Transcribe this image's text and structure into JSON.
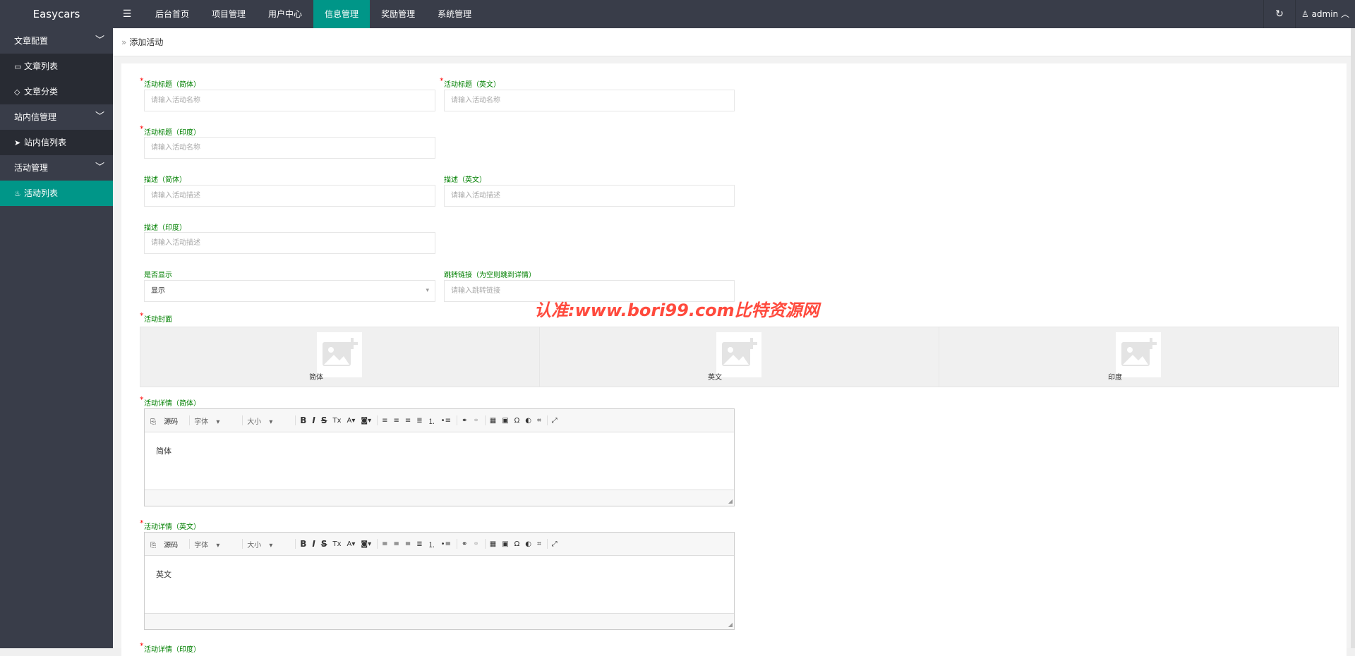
{
  "app": {
    "logo": "Easycars",
    "menu_icon": "menu-icon",
    "refresh_icon": "refresh-icon",
    "user": "admin"
  },
  "nav": [
    "后台首页",
    "项目管理",
    "用户中心",
    "信息管理",
    "奖励管理",
    "系统管理"
  ],
  "nav_active": "信息管理",
  "sidebar": {
    "groups": [
      {
        "label": "文章配置",
        "items": [
          "文章列表",
          "文章分类"
        ]
      },
      {
        "label": "站内信管理",
        "items": [
          "站内信列表"
        ]
      },
      {
        "label": "活动管理",
        "items": [
          "活动列表"
        ]
      }
    ],
    "active_item": "活动列表"
  },
  "breadcrumb": "添加活动",
  "form": {
    "title_cn": {
      "label": "活动标题（简体）",
      "placeholder": "请输入活动名称"
    },
    "title_en": {
      "label": "活动标题（英文）",
      "placeholder": "请输入活动名称"
    },
    "title_in": {
      "label": "活动标题（印度）",
      "placeholder": "请输入活动名称"
    },
    "desc_cn": {
      "label": "描述（简体）",
      "placeholder": "请输入活动描述"
    },
    "desc_en": {
      "label": "描述（英文）",
      "placeholder": "请输入活动描述"
    },
    "desc_in": {
      "label": "描述（印度）",
      "placeholder": "请输入活动描述"
    },
    "show": {
      "label": "是否显示",
      "value": "显示"
    },
    "link": {
      "label": "跳转链接（为空则跳到详情）",
      "placeholder": "请输入跳转链接"
    },
    "cover": {
      "label": "活动封面",
      "items": [
        "简体",
        "英文",
        "印度"
      ]
    },
    "detail_cn": {
      "label": "活动详情（简体）",
      "content": "简体"
    },
    "detail_en": {
      "label": "活动详情（英文）",
      "content": "英文"
    },
    "detail_in": {
      "label": "活动详情（印度）"
    }
  },
  "editor_toolbar": {
    "source": "源码",
    "font": "字体",
    "size": "大小",
    "bold": "B",
    "italic": "I",
    "strike": "S",
    "table": "▦",
    "omega": "Ω"
  },
  "watermark": "认准:www.bori99.com比特资源网",
  "colors": {
    "accent": "#009688",
    "topbar": "#393d49",
    "label": "#008000",
    "required": "#ff0000"
  }
}
